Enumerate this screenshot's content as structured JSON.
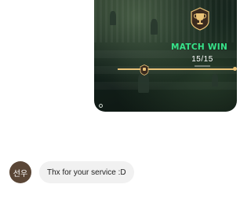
{
  "attachment": {
    "title": "MATCH WIN",
    "score": "15/15",
    "icons": [
      "trophy-icon",
      "mini-trophy-icon"
    ],
    "progress": 1.0,
    "accent_color": "#37e38a",
    "gold_color": "#e9c277"
  },
  "received": {
    "avatar_label": "선우",
    "avatar_color": "#5a4636",
    "text": "Thx for your service :D"
  }
}
